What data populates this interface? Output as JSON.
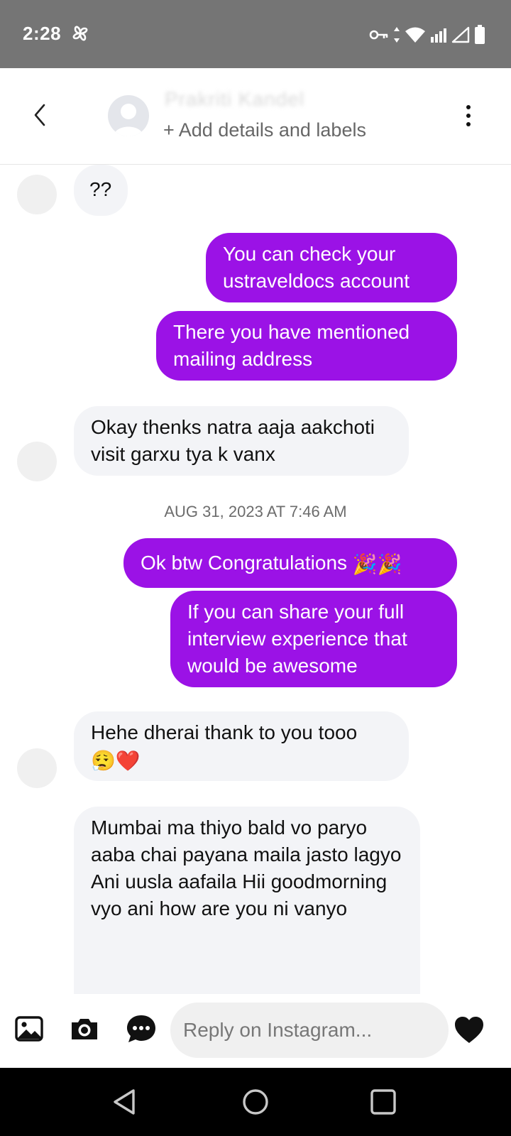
{
  "status_bar": {
    "time": "2:28",
    "icons": [
      "pinwheel-icon",
      "vpn-key-icon",
      "data-arrows-icon",
      "wifi-icon",
      "signal-icon",
      "signal-empty-icon",
      "battery-icon"
    ]
  },
  "header": {
    "contact_name": "Prakriti Kandel",
    "subtitle": "+ Add details and labels",
    "icons": [
      "back-chevron-icon",
      "profile-placeholder-icon",
      "more-vertical-icon"
    ]
  },
  "messages": [
    {
      "direction": "incoming",
      "text": "??"
    },
    {
      "direction": "outgoing",
      "text": "You can check your ustraveldocs account"
    },
    {
      "direction": "outgoing",
      "text": "There you have mentioned mailing address"
    },
    {
      "direction": "incoming",
      "text": "Okay thenks natra aaja aakchoti visit garxu tya k vanx"
    },
    {
      "direction": "timestamp",
      "text": "AUG 31, 2023 AT 7:46 AM"
    },
    {
      "direction": "outgoing",
      "text": "Ok btw Congratulations 🎉🎉"
    },
    {
      "direction": "outgoing",
      "text": "If you can share your full interview experience that would be awesome"
    },
    {
      "direction": "incoming",
      "text": "Hehe dherai thank to you tooo 😮‍💨❤️"
    },
    {
      "direction": "incoming",
      "text": "Mumbai ma thiyo bald vo paryo aaba chai payana maila jasto lagyo\nAni uusla aafaila Hii goodmorning vyo ani how are you ni vanyo"
    }
  ],
  "composer": {
    "placeholder": "Reply on Instagram...",
    "icons": [
      "gallery-icon",
      "camera-icon",
      "sticker-chat-icon",
      "heart-icon"
    ]
  },
  "nav_bar": {
    "icons": [
      "back-triangle-icon",
      "home-circle-icon",
      "recents-square-icon"
    ]
  },
  "colors": {
    "outgoing_bubble": "#9b12e6",
    "incoming_bubble": "#f3f4f7",
    "status_bar": "#757575"
  }
}
